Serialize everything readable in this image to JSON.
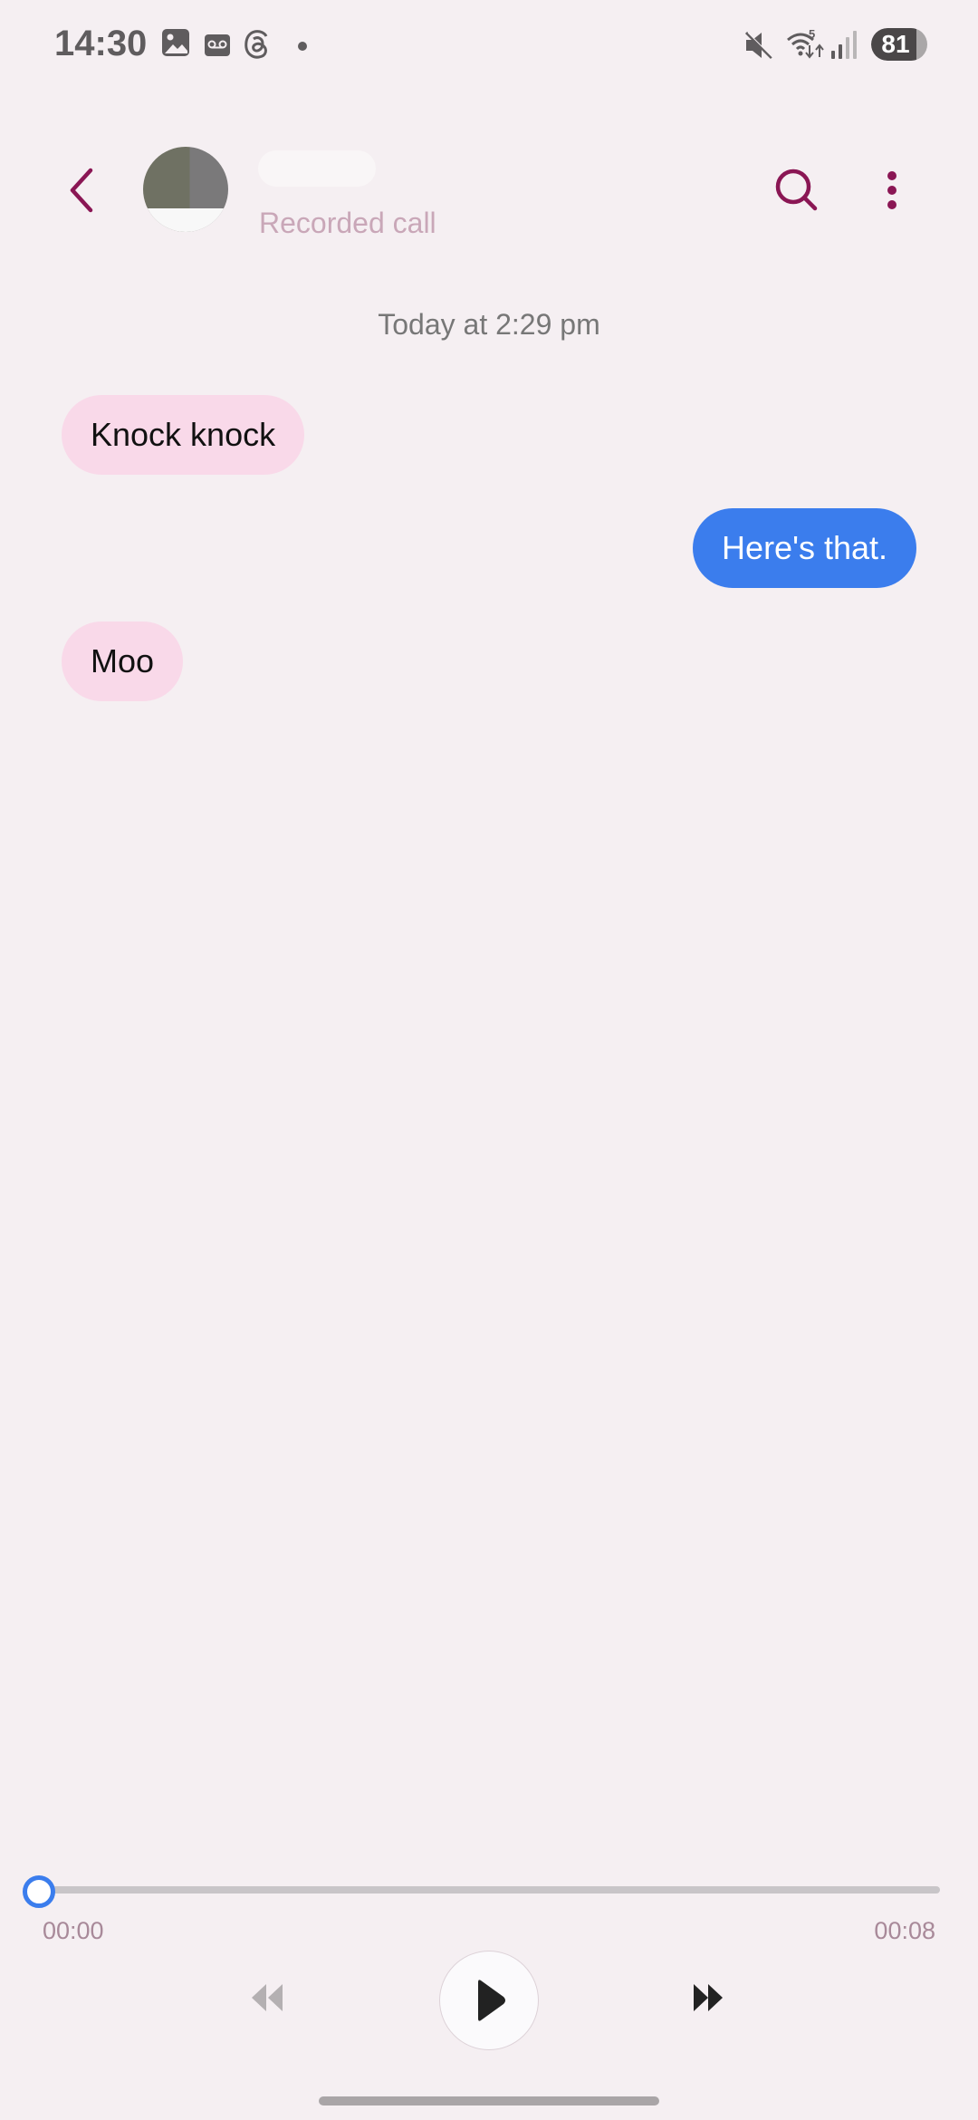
{
  "status_bar": {
    "time": "14:30",
    "left_icons": [
      "gallery-icon",
      "voicemail-icon",
      "threads-icon",
      "dot-icon"
    ],
    "right_icons": [
      "mute-icon",
      "wifi-icon",
      "signal-icon"
    ],
    "wifi_label": "5",
    "battery": "81",
    "battery_level": 0.81
  },
  "header": {
    "contact_name": "",
    "subtitle": "Recorded call",
    "accent_color": "#8a1654"
  },
  "conversation": {
    "date_label": "Today at 2:29 pm",
    "messages": [
      {
        "direction": "incoming",
        "text": "Knock knock"
      },
      {
        "direction": "outgoing",
        "text": "Here's that."
      },
      {
        "direction": "incoming",
        "text": "Moo"
      }
    ]
  },
  "player": {
    "current_time": "00:00",
    "duration": "00:08",
    "progress": 0
  },
  "colors": {
    "background": "#f5eff2",
    "incoming_bubble": "#f9d9e9",
    "outgoing_bubble": "#3b7ded",
    "seek_accent": "#3b7ded"
  }
}
